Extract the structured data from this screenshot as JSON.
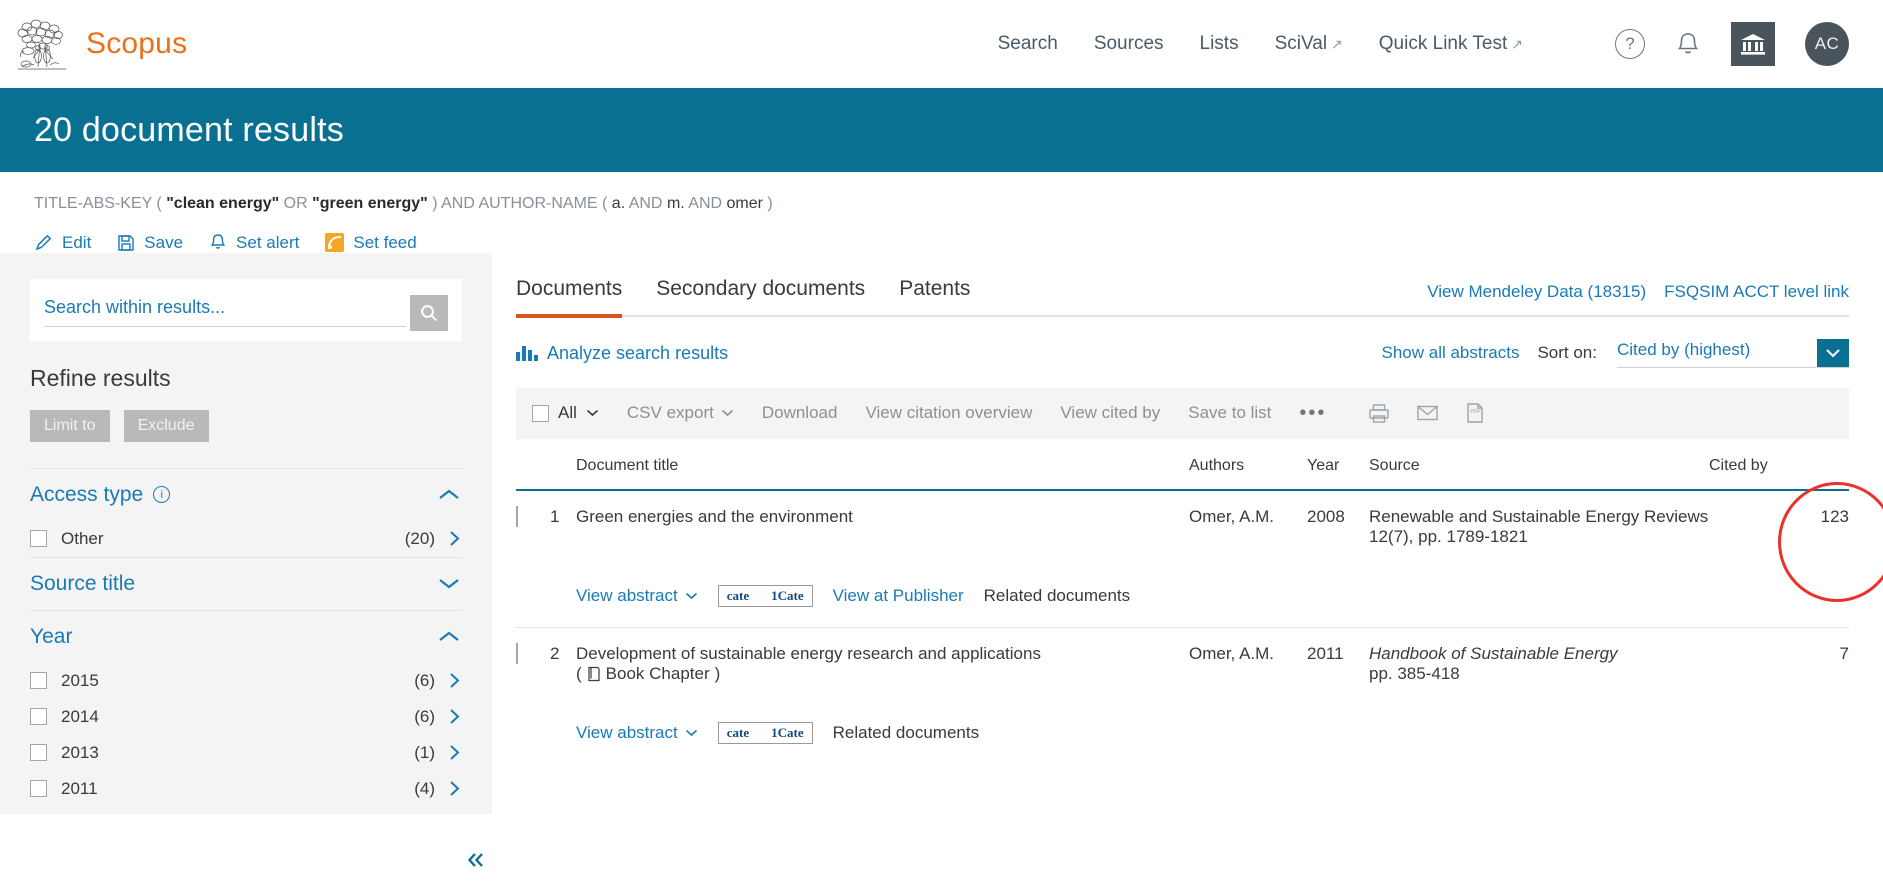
{
  "header": {
    "brand": "Scopus",
    "logo_icon": "elsevier-tree-logo",
    "nav": [
      {
        "label": "Search",
        "external": false
      },
      {
        "label": "Sources",
        "external": false
      },
      {
        "label": "Lists",
        "external": false
      },
      {
        "label": "SciVal",
        "external": true
      },
      {
        "label": "Quick Link Test",
        "external": true
      }
    ],
    "external_marker": "↗",
    "icons": {
      "help": "?",
      "help_name": "help-icon",
      "notifications_name": "bell-icon",
      "institution_name": "institution-icon"
    },
    "avatar_initials": "AC"
  },
  "banner": {
    "title": "20 document results",
    "background": "#0a7092"
  },
  "query": {
    "parts": [
      {
        "text": "TITLE-ABS-KEY",
        "type": "field"
      },
      {
        "text": "(",
        "type": "paren"
      },
      {
        "text": "\"clean energy\"",
        "type": "term"
      },
      {
        "text": "OR",
        "type": "op"
      },
      {
        "text": "\"green energy\"",
        "type": "term"
      },
      {
        "text": ")",
        "type": "paren"
      },
      {
        "text": "AND",
        "type": "op"
      },
      {
        "text": "AUTHOR-NAME",
        "type": "field"
      },
      {
        "text": "(",
        "type": "paren"
      },
      {
        "text": "a.",
        "type": "val"
      },
      {
        "text": "AND",
        "type": "op"
      },
      {
        "text": "m.",
        "type": "val"
      },
      {
        "text": "AND",
        "type": "op"
      },
      {
        "text": "omer",
        "type": "val"
      },
      {
        "text": ")",
        "type": "paren"
      }
    ],
    "actions": [
      {
        "label": "Edit",
        "icon": "pencil-icon"
      },
      {
        "label": "Save",
        "icon": "floppy-disk-icon"
      },
      {
        "label": "Set alert",
        "icon": "bell-icon"
      },
      {
        "label": "Set feed",
        "icon": "rss-icon"
      }
    ]
  },
  "sidebar": {
    "search_placeholder": "Search within results...",
    "search_value": "",
    "search_icon": "search-icon",
    "refine_title": "Refine results",
    "limit_to": "Limit to",
    "exclude": "Exclude",
    "collapse_icon": "double-chevron-left-icon",
    "facets": [
      {
        "title": "Access type",
        "expanded": true,
        "has_info": true,
        "items": [
          {
            "label": "Other",
            "count": "(20)"
          }
        ]
      },
      {
        "title": "Source title",
        "expanded": false,
        "has_info": false,
        "items": []
      },
      {
        "title": "Year",
        "expanded": true,
        "has_info": false,
        "items": [
          {
            "label": "2015",
            "count": "(6)"
          },
          {
            "label": "2014",
            "count": "(6)"
          },
          {
            "label": "2013",
            "count": "(1)"
          },
          {
            "label": "2011",
            "count": "(4)"
          }
        ]
      }
    ]
  },
  "content": {
    "tabs": [
      {
        "label": "Documents",
        "active": true
      },
      {
        "label": "Secondary documents",
        "active": false
      },
      {
        "label": "Patents",
        "active": false
      }
    ],
    "tab_links": [
      {
        "label": "View Mendeley Data (18315)"
      },
      {
        "label": "FSQSIM ACCT level link"
      }
    ],
    "analyze_label": "Analyze search results",
    "analyze_icon": "bar-chart-icon",
    "show_abstracts": "Show all abstracts",
    "sort_label": "Sort on:",
    "sort_value": "Cited by (highest)",
    "sort_chevron_icon": "chevron-down-icon",
    "toolbar": {
      "all_label": "All",
      "items": [
        {
          "label": "CSV export",
          "caret": true
        },
        {
          "label": "Download",
          "caret": false
        },
        {
          "label": "View citation overview",
          "caret": false
        },
        {
          "label": "View cited by",
          "caret": false
        },
        {
          "label": "Save to list",
          "caret": false
        }
      ],
      "more": "•••",
      "icons": [
        "print-icon",
        "email-icon",
        "pdf-icon"
      ]
    },
    "columns": {
      "title": "Document title",
      "authors": "Authors",
      "year": "Year",
      "source": "Source",
      "cited_by": "Cited by"
    },
    "rows": [
      {
        "num": "1",
        "title": "Green energies and the environment",
        "doctype": "",
        "authors": "Omer, A.M.",
        "year": "2008",
        "source_line1": "Renewable and Sustainable Energy Reviews",
        "source_line2": "12(7), pp. 1789-1821",
        "source_italic": false,
        "cited_by": "123",
        "links": [
          {
            "label": "View abstract",
            "caret": true
          },
          {
            "label": "View at Publisher",
            "caret": false
          },
          {
            "label": "Related documents",
            "caret": false
          }
        ],
        "resolver_left": "cate",
        "resolver_right": "1Cate"
      },
      {
        "num": "2",
        "title": "Development of sustainable energy research and applications",
        "doctype": "Book Chapter",
        "doctype_icon": "book-icon",
        "authors": "Omer, A.M.",
        "year": "2011",
        "source_line1": "Handbook of Sustainable Energy",
        "source_line2": "pp. 385-418",
        "source_italic": true,
        "cited_by": "7",
        "links": [
          {
            "label": "View abstract",
            "caret": true
          },
          {
            "label": "Related documents",
            "caret": false
          }
        ],
        "resolver_left": "cate",
        "resolver_right": "1Cate"
      }
    ]
  },
  "annotation": {
    "color": "#e8322a",
    "target": "cited-by-column"
  }
}
